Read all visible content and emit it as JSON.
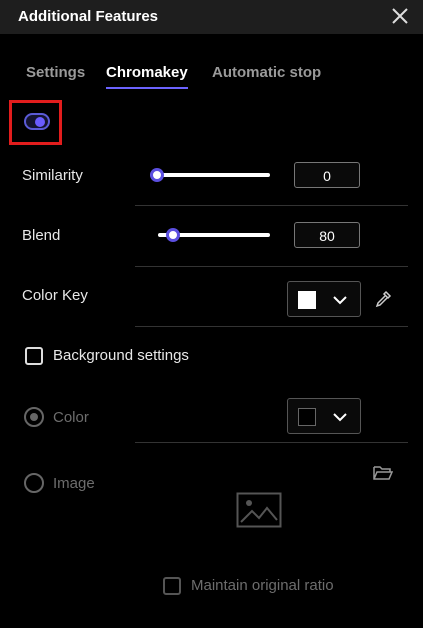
{
  "window": {
    "title": "Additional Features"
  },
  "tabs": [
    {
      "label": "Settings",
      "active": false
    },
    {
      "label": "Chromakey",
      "active": true
    },
    {
      "label": "Automatic stop",
      "active": false
    }
  ],
  "chromakey": {
    "enabled": true,
    "similarity": {
      "label": "Similarity",
      "value": "0",
      "level": 0
    },
    "blend": {
      "label": "Blend",
      "value": "80",
      "level": 0.08
    },
    "color_key": {
      "label": "Color Key",
      "color": "#ffffff"
    }
  },
  "background": {
    "label": "Background settings",
    "checked": false,
    "color_option": {
      "label": "Color",
      "selected": true,
      "color": "#000000"
    },
    "image_option": {
      "label": "Image",
      "selected": false
    },
    "maintain_ratio": {
      "label": "Maintain original ratio",
      "checked": false
    }
  },
  "icons": {
    "close": "close-icon",
    "eyedropper": "eyedropper-icon",
    "folder": "folder-open-icon",
    "image_placeholder": "image-placeholder-icon"
  },
  "colors": {
    "accent": "#5b4fe0",
    "highlight": "#e21d1d"
  }
}
